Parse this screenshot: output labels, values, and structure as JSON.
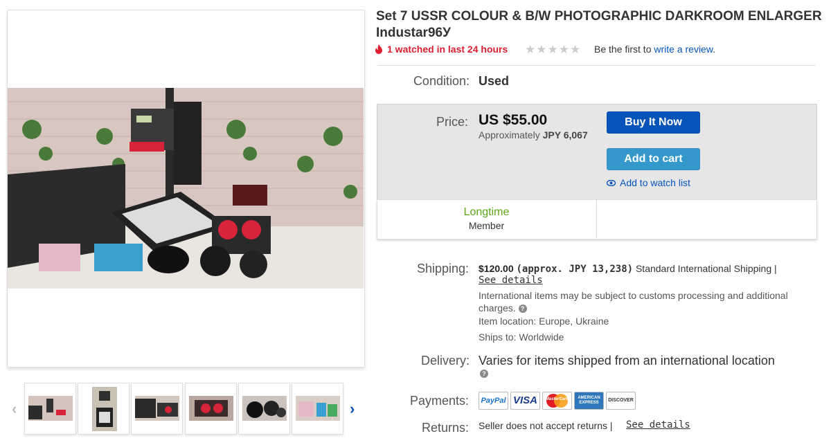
{
  "title": "Set 7 USSR COLOUR & B/W PHOTOGRAPHIC DARKROOM ENLARGER Industar96У",
  "watch_notice": "1 watched in last 24 hours",
  "rating": {
    "stars_filled": 0,
    "stars_total": 5,
    "prefix": "Be the first to",
    "link": "write a review",
    "suffix": "."
  },
  "condition": {
    "label": "Condition:",
    "value": "Used"
  },
  "price": {
    "label": "Price:",
    "value": "US $55.00",
    "approx_prefix": "Approximately",
    "approx_value": "JPY 6,067"
  },
  "buttons": {
    "buy_now": "Buy It Now",
    "add_to_cart": "Add to cart",
    "watch_list": "Add to watch list"
  },
  "seller": {
    "badge_line1": "Longtime",
    "badge_line2": "Member"
  },
  "shipping": {
    "label": "Shipping:",
    "cost": "$120.00",
    "approx": "(approx. JPY 13,238)",
    "method": "Standard International Shipping |",
    "details_link": "See details",
    "customs_note": "International items may be subject to customs processing and additional charges.",
    "location": "Item location: Europe, Ukraine",
    "ships_to": "Ships to: Worldwide"
  },
  "delivery": {
    "label": "Delivery:",
    "value": "Varies for items shipped from an international location"
  },
  "payments": {
    "label": "Payments:",
    "methods": [
      "PayPal",
      "VISA",
      "MasterCard",
      "AMERICAN EXPRESS",
      "DISCOVER"
    ]
  },
  "returns": {
    "label": "Returns:",
    "value": "Seller does not accept returns |",
    "details_link": "See details"
  },
  "gallery": {
    "thumbnail_count": 6,
    "prev_icon": "chevron-left-icon",
    "next_icon": "chevron-right-icon"
  },
  "colors": {
    "link": "#0654ba",
    "buy_button": "#0654ba",
    "cart_button": "#3498ca",
    "watch_alert": "#dd1e31",
    "seller_green": "#5ba71b"
  }
}
